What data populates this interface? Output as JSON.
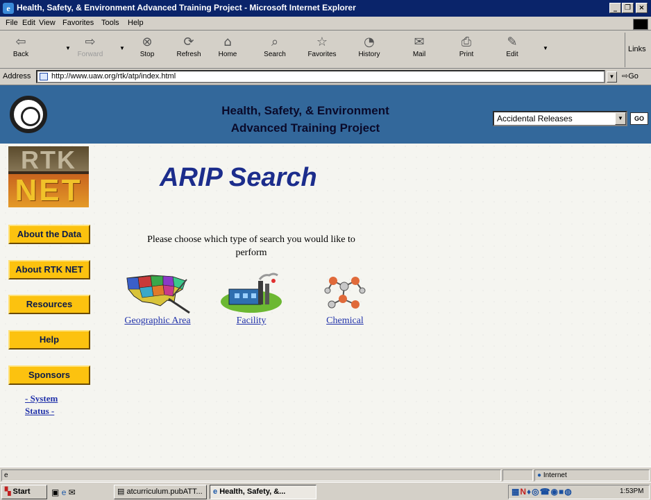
{
  "window": {
    "title": "Health, Safety, & Environment Advanced Training Project - Microsoft Internet Explorer",
    "minimize": "_",
    "maximize": "❐",
    "close": "×"
  },
  "menu": [
    "File",
    "Edit",
    "View",
    "Favorites",
    "Tools",
    "Help"
  ],
  "toolbar": {
    "back": "Back",
    "forward": "Forward",
    "stop": "Stop",
    "refresh": "Refresh",
    "home": "Home",
    "search": "Search",
    "favorites": "Favorites",
    "history": "History",
    "mail": "Mail",
    "print": "Print",
    "edit": "Edit",
    "links": "Links"
  },
  "address": {
    "label": "Address",
    "url": "http://www.uaw.org/rtk/atp/index.html",
    "go": "Go"
  },
  "banner": {
    "title_line1": "Health, Safety, & Environment",
    "title_line2": "Advanced Training Project",
    "select_value": "Accidental Releases",
    "go": "GO",
    "logo_text": "UAW"
  },
  "logo": {
    "top": "RTK",
    "bottom": "NET"
  },
  "sidebar": [
    {
      "label": "About the Data"
    },
    {
      "label": "About RTK NET"
    },
    {
      "label": "Resources"
    },
    {
      "label": "Help"
    },
    {
      "label": "Sponsors"
    }
  ],
  "system_status": {
    "line1": "- System",
    "line2": "Status -"
  },
  "main": {
    "heading": "ARIP Search",
    "prompt_line1": "Please choose which type of search you would like to",
    "prompt_line2": "perform",
    "choices": [
      {
        "label": "Geographic Area",
        "icon": "us-map-icon"
      },
      {
        "label": "Facility",
        "icon": "factory-icon"
      },
      {
        "label": "Chemical",
        "icon": "molecule-icon"
      }
    ]
  },
  "statusbar": {
    "zone": "Internet"
  },
  "taskbar": {
    "start": "Start",
    "tasks": [
      {
        "label": "atcurriculum.pubATT..."
      },
      {
        "label": "Health, Safety, &..."
      }
    ],
    "clock": "1:53PM"
  },
  "colors": {
    "banner": "#33689b",
    "button_gold": "#fcc20f",
    "heading": "#1c2d8c",
    "link": "#2233aa"
  }
}
